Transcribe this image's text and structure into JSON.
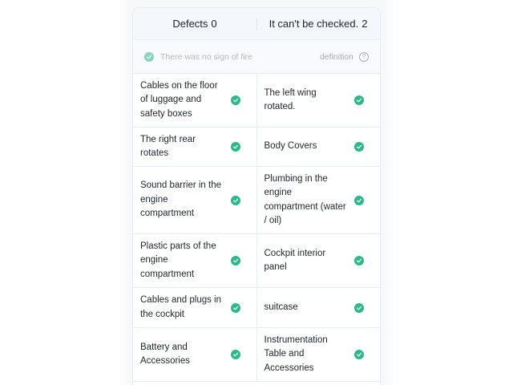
{
  "summary": {
    "defects_label": "Defects",
    "defects_count": "0",
    "unchecked_label": "It can't be checked.",
    "unchecked_count": "2"
  },
  "fire_check": {
    "text": "There was no sign of fire",
    "definition_label": "definition",
    "help_glyph": "?"
  },
  "items": [
    {
      "label": "Cables on the floor of luggage and safety boxes",
      "status": "ok"
    },
    {
      "label": "The left wing rotated.",
      "status": "ok"
    },
    {
      "label": "The right rear rotates",
      "status": "ok"
    },
    {
      "label": "Body Covers",
      "status": "ok"
    },
    {
      "label": "Sound barrier in the engine compartment",
      "status": "ok"
    },
    {
      "label": "Plumbing in the engine compartment (water / oil)",
      "status": "ok"
    },
    {
      "label": "Plastic parts of the engine compartment",
      "status": "ok"
    },
    {
      "label": "Cockpit interior panel",
      "status": "ok"
    },
    {
      "label": "Cables and plugs in the cockpit",
      "status": "ok"
    },
    {
      "label": "suitcase",
      "status": "ok"
    },
    {
      "label": "Battery and Accessories",
      "status": "ok"
    },
    {
      "label": "Instrumentation Table and Accessories",
      "status": "ok"
    }
  ],
  "colors": {
    "ok_green": "#2bb88a",
    "header_bg": "#f4f7fc",
    "divider": "#e8edf3"
  }
}
